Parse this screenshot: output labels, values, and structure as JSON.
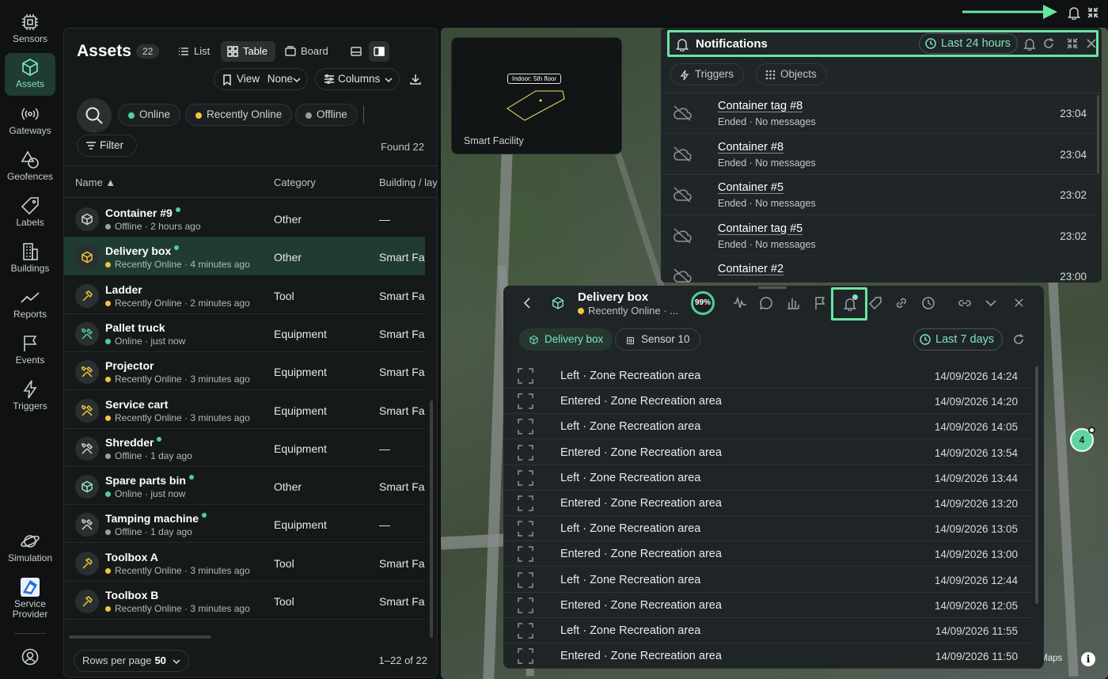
{
  "nav": {
    "items": [
      {
        "label": "Sensors",
        "icon": "chip-icon"
      },
      {
        "label": "Assets",
        "icon": "cube-icon"
      },
      {
        "label": "Gateways",
        "icon": "broadcast-icon"
      },
      {
        "label": "Geofences",
        "icon": "shapes-icon"
      },
      {
        "label": "Labels",
        "icon": "tag-icon"
      },
      {
        "label": "Buildings",
        "icon": "building-icon"
      },
      {
        "label": "Reports",
        "icon": "chart-line-icon"
      },
      {
        "label": "Events",
        "icon": "flag-icon"
      },
      {
        "label": "Triggers",
        "icon": "lightning-icon"
      }
    ],
    "bottom": [
      {
        "label": "Simulation",
        "icon": "planet-icon"
      },
      {
        "label": "Service Provider",
        "icon": "provider-logo-icon"
      }
    ]
  },
  "assets": {
    "title": "Assets",
    "count": "22",
    "views": [
      "List",
      "Table",
      "Board"
    ],
    "view_selector": {
      "label": "View",
      "value": "None"
    },
    "columns_label": "Columns",
    "statuses": [
      "Online",
      "Recently Online",
      "Offline"
    ],
    "filter_label": "Filter",
    "found": "Found 22",
    "headers": {
      "name": "Name ▲",
      "category": "Category",
      "building": "Building / layer"
    },
    "rows": [
      {
        "name": "Container #9",
        "dot": true,
        "status": "offline",
        "sub": "Offline · 2 hours ago",
        "category": "Other",
        "building": "—",
        "icon": "cube-icon"
      },
      {
        "name": "Delivery box",
        "dot": true,
        "status": "recent",
        "sub": "Recently Online · 4 minutes ago",
        "category": "Other",
        "building": "Smart Fa...",
        "icon": "cube-icon",
        "selected": true
      },
      {
        "name": "Ladder",
        "dot": false,
        "status": "recent",
        "sub": "Recently Online · 2 minutes ago",
        "category": "Tool",
        "building": "Smart Fa...",
        "icon": "hammer-icon"
      },
      {
        "name": "Pallet truck",
        "dot": false,
        "status": "online",
        "sub": "Online · just now",
        "category": "Equipment",
        "building": "Smart Fa...",
        "icon": "tools-icon"
      },
      {
        "name": "Projector",
        "dot": false,
        "status": "recent",
        "sub": "Recently Online · 3 minutes ago",
        "category": "Equipment",
        "building": "Smart Fa...",
        "icon": "tools-icon"
      },
      {
        "name": "Service cart",
        "dot": false,
        "status": "recent",
        "sub": "Recently Online · 3 minutes ago",
        "category": "Equipment",
        "building": "Smart Fa...",
        "icon": "tools-icon"
      },
      {
        "name": "Shredder",
        "dot": true,
        "status": "offline",
        "sub": "Offline · 1 day ago",
        "category": "Equipment",
        "building": "—",
        "icon": "tools-icon"
      },
      {
        "name": "Spare parts bin",
        "dot": true,
        "status": "online",
        "sub": "Online · just now",
        "category": "Other",
        "building": "Smart Fa...",
        "icon": "cube-icon"
      },
      {
        "name": "Tamping machine",
        "dot": true,
        "status": "offline",
        "sub": "Offline · 1 day ago",
        "category": "Equipment",
        "building": "—",
        "icon": "tools-icon"
      },
      {
        "name": "Toolbox A",
        "dot": false,
        "status": "recent",
        "sub": "Recently Online · 3 minutes ago",
        "category": "Tool",
        "building": "Smart Fa...",
        "icon": "hammer-icon"
      },
      {
        "name": "Toolbox B",
        "dot": false,
        "status": "recent",
        "sub": "Recently Online · 3 minutes ago",
        "category": "Tool",
        "building": "Smart Fa...",
        "icon": "hammer-icon"
      }
    ],
    "rows_per_page_label": "Rows per page",
    "rows_per_page": "50",
    "pager": "1–22 of 22"
  },
  "map": {
    "facility_name": "Smart Facility",
    "floor_tag": "Indoor: 5th floor",
    "cluster_count": "4",
    "credit": "le Maps",
    "info": "i"
  },
  "notifications": {
    "title": "Notifications",
    "range": "Last 24 hours",
    "chips": [
      "Triggers",
      "Objects"
    ],
    "items": [
      {
        "title": "Container tag #8",
        "sub": "Ended · No messages",
        "time": "23:04"
      },
      {
        "title": "Container #8",
        "sub": "Ended · No messages",
        "time": "23:04"
      },
      {
        "title": "Container #5",
        "sub": "Ended · No messages",
        "time": "23:02"
      },
      {
        "title": "Container tag #5",
        "sub": "Ended · No messages",
        "time": "23:02"
      },
      {
        "title": "Container #2",
        "sub": "",
        "time": "23:00"
      }
    ]
  },
  "detail": {
    "title": "Delivery box",
    "sub": "Recently Online · ...",
    "battery": "99%",
    "chips": [
      "Delivery box",
      "Sensor 10"
    ],
    "range": "Last 7 days",
    "events": [
      {
        "text": "Left · Zone Recreation area",
        "date": "14/09/2026 14:24"
      },
      {
        "text": "Entered · Zone Recreation area",
        "date": "14/09/2026 14:20"
      },
      {
        "text": "Left · Zone Recreation area",
        "date": "14/09/2026 14:05"
      },
      {
        "text": "Entered · Zone Recreation area",
        "date": "14/09/2026 13:54"
      },
      {
        "text": "Left · Zone Recreation area",
        "date": "14/09/2026 13:44"
      },
      {
        "text": "Entered · Zone Recreation area",
        "date": "14/09/2026 13:20"
      },
      {
        "text": "Left · Zone Recreation area",
        "date": "14/09/2026 13:05"
      },
      {
        "text": "Entered · Zone Recreation area",
        "date": "14/09/2026 13:00"
      },
      {
        "text": "Left · Zone Recreation area",
        "date": "14/09/2026 12:44"
      },
      {
        "text": "Entered · Zone Recreation area",
        "date": "14/09/2026 12:05"
      },
      {
        "text": "Left · Zone Recreation area",
        "date": "14/09/2026 11:55"
      },
      {
        "text": "Entered · Zone Recreation area",
        "date": "14/09/2026 11:50"
      }
    ]
  },
  "colors": {
    "online": "#4fd09b",
    "recent": "#f3c53d",
    "offline": "#9aa0a0",
    "accent": "#7fe3c0",
    "highlight": "#69e6a2"
  }
}
